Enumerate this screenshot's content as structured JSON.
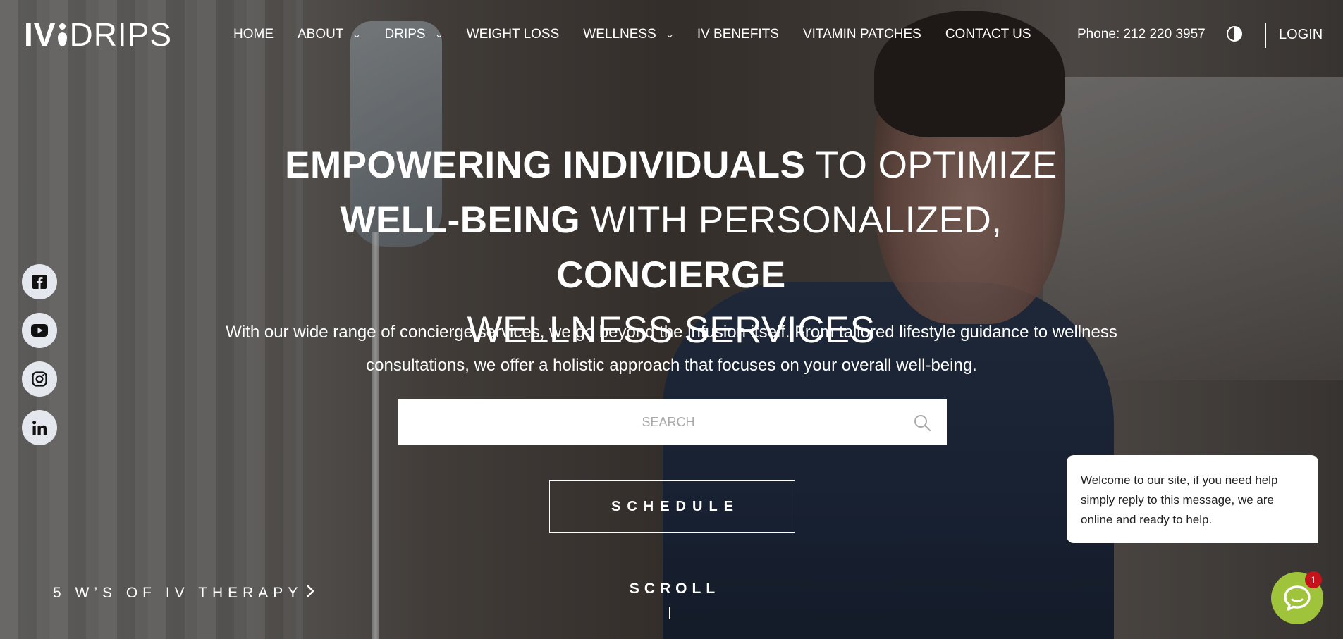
{
  "brand": {
    "logo_left": "IV",
    "logo_right": "DRIPS"
  },
  "nav": {
    "items": [
      {
        "label": "HOME",
        "has_dropdown": false
      },
      {
        "label": "ABOUT",
        "has_dropdown": true
      },
      {
        "label": "DRIPS",
        "has_dropdown": true
      },
      {
        "label": "WEIGHT LOSS",
        "has_dropdown": false
      },
      {
        "label": "WELLNESS",
        "has_dropdown": true
      },
      {
        "label": "IV BENEFITS",
        "has_dropdown": false
      },
      {
        "label": "VITAMIN PATCHES",
        "has_dropdown": false
      },
      {
        "label": "CONTACT US",
        "has_dropdown": false
      }
    ],
    "phone": "Phone: 212 220 3957",
    "login": "LOGIN",
    "contrast_icon": "contrast-icon"
  },
  "hero": {
    "title_parts": {
      "p1_bold": "EMPOWERING INDIVIDUALS",
      "p1_light": " TO OPTIMIZE",
      "p2_bold": "WELL-BEING",
      "p2_light": " WITH PERSONALIZED, ",
      "p2_bold2": "CONCIERGE",
      "p3_light": "WELLNESS SERVICES"
    },
    "subtitle": "With our wide range of concierge services, we go beyond the infusion itself. From tailored lifestyle guidance to wellness consultations, we offer a holistic approach that focuses on your overall well-being.",
    "search_placeholder": "SEARCH",
    "schedule_label": "SCHEDULE",
    "five_ws_label": "5 W’S OF IV THERAPY",
    "scroll_label": "SCROLL"
  },
  "socials": [
    "facebook-icon",
    "youtube-icon",
    "instagram-icon",
    "linkedin-icon"
  ],
  "chat": {
    "message": "Welcome to our site, if you need help simply reply to this message, we are online and ready to help.",
    "badge_count": "1"
  },
  "colors": {
    "chat_button": "#9fc33a",
    "badge": "#c4131b",
    "social_bg": "#e4e8ee"
  }
}
